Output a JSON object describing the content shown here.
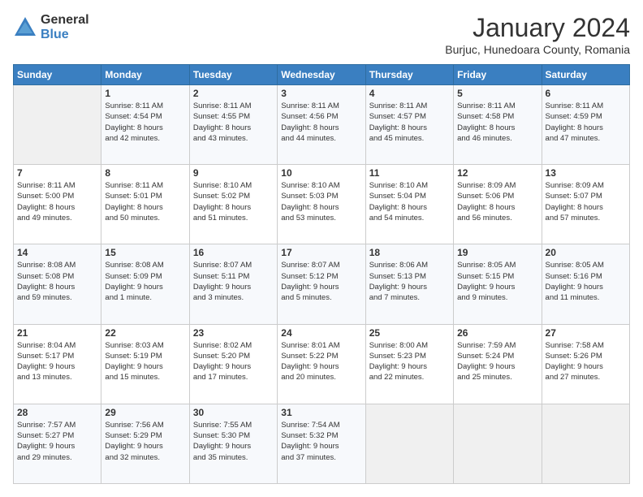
{
  "logo": {
    "general": "General",
    "blue": "Blue"
  },
  "title": "January 2024",
  "subtitle": "Burjuc, Hunedoara County, Romania",
  "days_header": [
    "Sunday",
    "Monday",
    "Tuesday",
    "Wednesday",
    "Thursday",
    "Friday",
    "Saturday"
  ],
  "weeks": [
    [
      {
        "day": "",
        "info": ""
      },
      {
        "day": "1",
        "info": "Sunrise: 8:11 AM\nSunset: 4:54 PM\nDaylight: 8 hours\nand 42 minutes."
      },
      {
        "day": "2",
        "info": "Sunrise: 8:11 AM\nSunset: 4:55 PM\nDaylight: 8 hours\nand 43 minutes."
      },
      {
        "day": "3",
        "info": "Sunrise: 8:11 AM\nSunset: 4:56 PM\nDaylight: 8 hours\nand 44 minutes."
      },
      {
        "day": "4",
        "info": "Sunrise: 8:11 AM\nSunset: 4:57 PM\nDaylight: 8 hours\nand 45 minutes."
      },
      {
        "day": "5",
        "info": "Sunrise: 8:11 AM\nSunset: 4:58 PM\nDaylight: 8 hours\nand 46 minutes."
      },
      {
        "day": "6",
        "info": "Sunrise: 8:11 AM\nSunset: 4:59 PM\nDaylight: 8 hours\nand 47 minutes."
      }
    ],
    [
      {
        "day": "7",
        "info": "Sunrise: 8:11 AM\nSunset: 5:00 PM\nDaylight: 8 hours\nand 49 minutes."
      },
      {
        "day": "8",
        "info": "Sunrise: 8:11 AM\nSunset: 5:01 PM\nDaylight: 8 hours\nand 50 minutes."
      },
      {
        "day": "9",
        "info": "Sunrise: 8:10 AM\nSunset: 5:02 PM\nDaylight: 8 hours\nand 51 minutes."
      },
      {
        "day": "10",
        "info": "Sunrise: 8:10 AM\nSunset: 5:03 PM\nDaylight: 8 hours\nand 53 minutes."
      },
      {
        "day": "11",
        "info": "Sunrise: 8:10 AM\nSunset: 5:04 PM\nDaylight: 8 hours\nand 54 minutes."
      },
      {
        "day": "12",
        "info": "Sunrise: 8:09 AM\nSunset: 5:06 PM\nDaylight: 8 hours\nand 56 minutes."
      },
      {
        "day": "13",
        "info": "Sunrise: 8:09 AM\nSunset: 5:07 PM\nDaylight: 8 hours\nand 57 minutes."
      }
    ],
    [
      {
        "day": "14",
        "info": "Sunrise: 8:08 AM\nSunset: 5:08 PM\nDaylight: 8 hours\nand 59 minutes."
      },
      {
        "day": "15",
        "info": "Sunrise: 8:08 AM\nSunset: 5:09 PM\nDaylight: 9 hours\nand 1 minute."
      },
      {
        "day": "16",
        "info": "Sunrise: 8:07 AM\nSunset: 5:11 PM\nDaylight: 9 hours\nand 3 minutes."
      },
      {
        "day": "17",
        "info": "Sunrise: 8:07 AM\nSunset: 5:12 PM\nDaylight: 9 hours\nand 5 minutes."
      },
      {
        "day": "18",
        "info": "Sunrise: 8:06 AM\nSunset: 5:13 PM\nDaylight: 9 hours\nand 7 minutes."
      },
      {
        "day": "19",
        "info": "Sunrise: 8:05 AM\nSunset: 5:15 PM\nDaylight: 9 hours\nand 9 minutes."
      },
      {
        "day": "20",
        "info": "Sunrise: 8:05 AM\nSunset: 5:16 PM\nDaylight: 9 hours\nand 11 minutes."
      }
    ],
    [
      {
        "day": "21",
        "info": "Sunrise: 8:04 AM\nSunset: 5:17 PM\nDaylight: 9 hours\nand 13 minutes."
      },
      {
        "day": "22",
        "info": "Sunrise: 8:03 AM\nSunset: 5:19 PM\nDaylight: 9 hours\nand 15 minutes."
      },
      {
        "day": "23",
        "info": "Sunrise: 8:02 AM\nSunset: 5:20 PM\nDaylight: 9 hours\nand 17 minutes."
      },
      {
        "day": "24",
        "info": "Sunrise: 8:01 AM\nSunset: 5:22 PM\nDaylight: 9 hours\nand 20 minutes."
      },
      {
        "day": "25",
        "info": "Sunrise: 8:00 AM\nSunset: 5:23 PM\nDaylight: 9 hours\nand 22 minutes."
      },
      {
        "day": "26",
        "info": "Sunrise: 7:59 AM\nSunset: 5:24 PM\nDaylight: 9 hours\nand 25 minutes."
      },
      {
        "day": "27",
        "info": "Sunrise: 7:58 AM\nSunset: 5:26 PM\nDaylight: 9 hours\nand 27 minutes."
      }
    ],
    [
      {
        "day": "28",
        "info": "Sunrise: 7:57 AM\nSunset: 5:27 PM\nDaylight: 9 hours\nand 29 minutes."
      },
      {
        "day": "29",
        "info": "Sunrise: 7:56 AM\nSunset: 5:29 PM\nDaylight: 9 hours\nand 32 minutes."
      },
      {
        "day": "30",
        "info": "Sunrise: 7:55 AM\nSunset: 5:30 PM\nDaylight: 9 hours\nand 35 minutes."
      },
      {
        "day": "31",
        "info": "Sunrise: 7:54 AM\nSunset: 5:32 PM\nDaylight: 9 hours\nand 37 minutes."
      },
      {
        "day": "",
        "info": ""
      },
      {
        "day": "",
        "info": ""
      },
      {
        "day": "",
        "info": ""
      }
    ]
  ]
}
